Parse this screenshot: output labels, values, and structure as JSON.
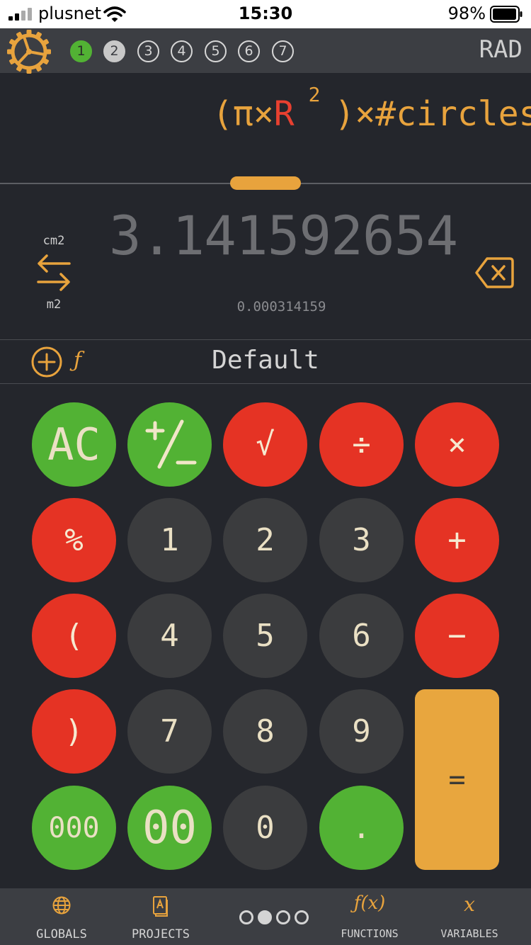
{
  "status_bar": {
    "carrier": "plusnet",
    "time": "15:30",
    "battery_percent": "98%"
  },
  "toolbar": {
    "pages": [
      "1",
      "2",
      "3",
      "4",
      "5",
      "6",
      "7"
    ],
    "active_page": "1",
    "angle_mode": "RAD"
  },
  "expression": {
    "open_paren": "(",
    "pi": "π",
    "times1": "×",
    "variable": "R",
    "exponent": "2",
    "close_paren": ")",
    "times2": "×",
    "tail": "#circles"
  },
  "result": {
    "value": "3.141592654",
    "converted": "0.000314159",
    "unit_from": "cm2",
    "unit_to": "m2"
  },
  "preset": {
    "name": "Default",
    "function_symbol": "ƒ"
  },
  "keypad": {
    "ac": "AC",
    "sqrt": "√",
    "divide": "÷",
    "multiply": "×",
    "percent": "%",
    "one": "1",
    "two": "2",
    "three": "3",
    "plus": "+",
    "open_paren": "(",
    "four": "4",
    "five": "5",
    "six": "6",
    "minus": "−",
    "close_paren": ")",
    "seven": "7",
    "eight": "8",
    "nine": "9",
    "equals": "=",
    "triple_zero": "000",
    "double_zero": "00",
    "zero": "0",
    "decimal": "."
  },
  "bottom_nav": {
    "globals": "GLOBALS",
    "projects": "PROJECTS",
    "functions": "FUNCTIONS",
    "functions_icon": "ƒ(x)",
    "variables": "VARIABLES",
    "variables_icon": "x"
  },
  "colors": {
    "accent_orange": "#e8a33d",
    "key_green": "#52b234",
    "key_red": "#e53324",
    "key_dark": "#3b3c3e",
    "background": "#24262c"
  }
}
